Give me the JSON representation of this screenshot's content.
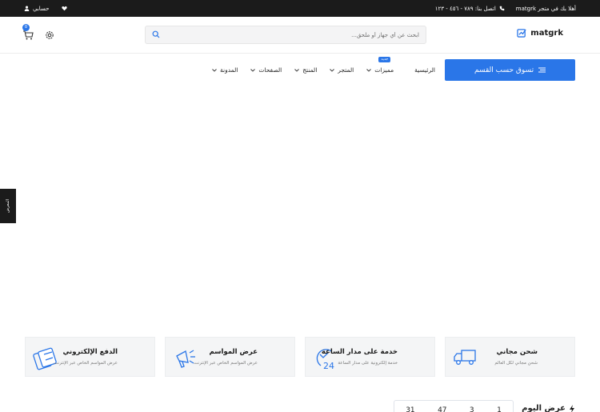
{
  "topbar": {
    "welcome": "أهلا بك في متجر matgrk",
    "phone": "اتصل بنا: ٧٨٩ - ٤٥٦ - ١٢٣",
    "account": "حسابي"
  },
  "header": {
    "logo_text": "matgrk",
    "search_placeholder": "ابحث عن أي جهاز أو ملحق...",
    "cart_count": "0"
  },
  "nav": {
    "category_button": "تسوق حسب القسم",
    "items": [
      {
        "label": "الرئيسية"
      },
      {
        "label": "مميزات",
        "badge": "جديد"
      },
      {
        "label": "المتجر"
      },
      {
        "label": "المنتج"
      },
      {
        "label": "الصفحات"
      },
      {
        "label": "المدونة"
      }
    ]
  },
  "side_tab": "المعرض",
  "features": [
    {
      "title": "شحن مجاني",
      "subtitle": "شحن مجاني لكل العالم",
      "icon": "truck-icon"
    },
    {
      "title": "خدمة على مدار الساعة",
      "subtitle": "خدمة إلكترونية على مدار الساعة",
      "icon": "clock-24-icon"
    },
    {
      "title": "عرض المواسم",
      "subtitle": "عرض المواسم الخاص عبر الإنترنت",
      "icon": "megaphone-icon"
    },
    {
      "title": "الدفع الإلكتروني",
      "subtitle": "عرض المواسم الخاص عبر الإنترنت",
      "icon": "credit-card-icon"
    }
  ],
  "deal": {
    "title": "عرض اليوم",
    "countdown": [
      "1",
      "3",
      "47",
      "31"
    ]
  },
  "colors": {
    "accent": "#2a76e8",
    "topbar": "#1b1b1b"
  }
}
